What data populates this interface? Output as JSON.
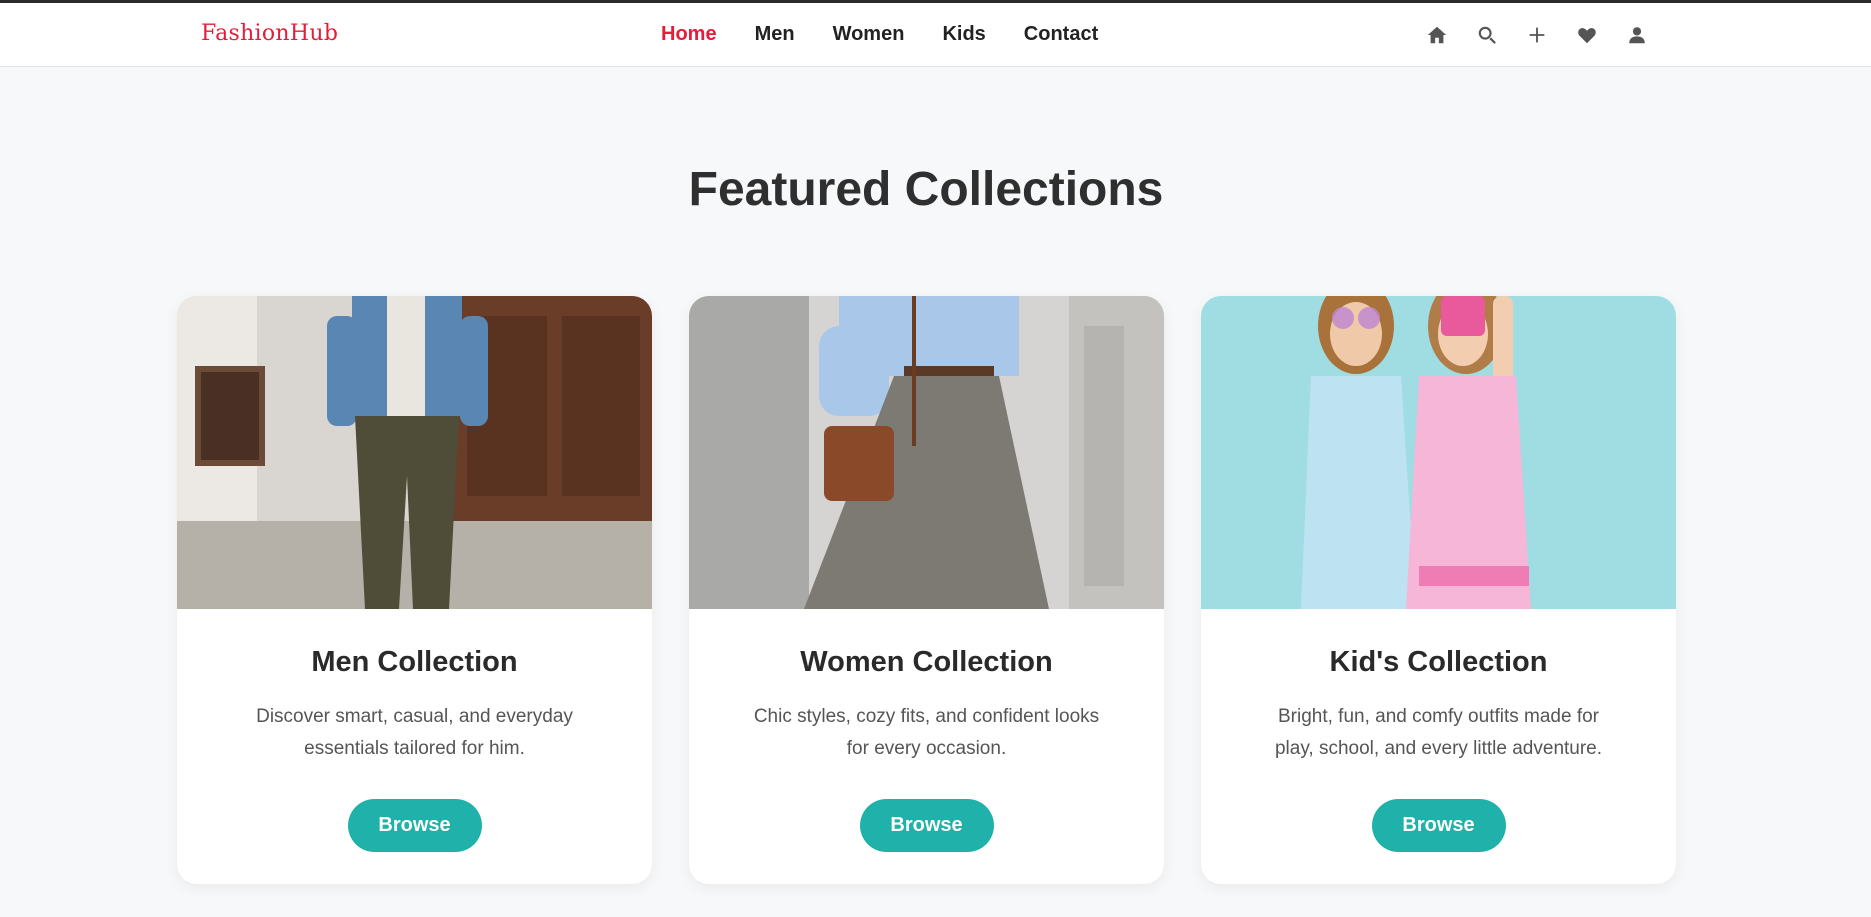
{
  "header": {
    "logo": "FashionHub",
    "nav": [
      {
        "label": "Home",
        "active": true
      },
      {
        "label": "Men",
        "active": false
      },
      {
        "label": "Women",
        "active": false
      },
      {
        "label": "Kids",
        "active": false
      },
      {
        "label": "Contact",
        "active": false
      }
    ],
    "icons": [
      "home-icon",
      "search-icon",
      "plus-icon",
      "heart-icon",
      "user-icon"
    ]
  },
  "main": {
    "title": "Featured Collections",
    "cards": [
      {
        "image": "men-photo",
        "title": "Men Collection",
        "description": "Discover smart, casual, and everyday essentials tailored for him.",
        "button": "Browse"
      },
      {
        "image": "women-photo",
        "title": "Women Collection",
        "description": "Chic styles, cozy fits, and confident looks for every occasion.",
        "button": "Browse"
      },
      {
        "image": "kids-photo",
        "title": "Kid's Collection",
        "description": "Bright, fun, and comfy outfits made for play, school, and every little adventure.",
        "button": "Browse"
      }
    ]
  },
  "colors": {
    "brand": "#e51d3a",
    "accent": "#20b2aa",
    "background": "#f7f8f9"
  }
}
